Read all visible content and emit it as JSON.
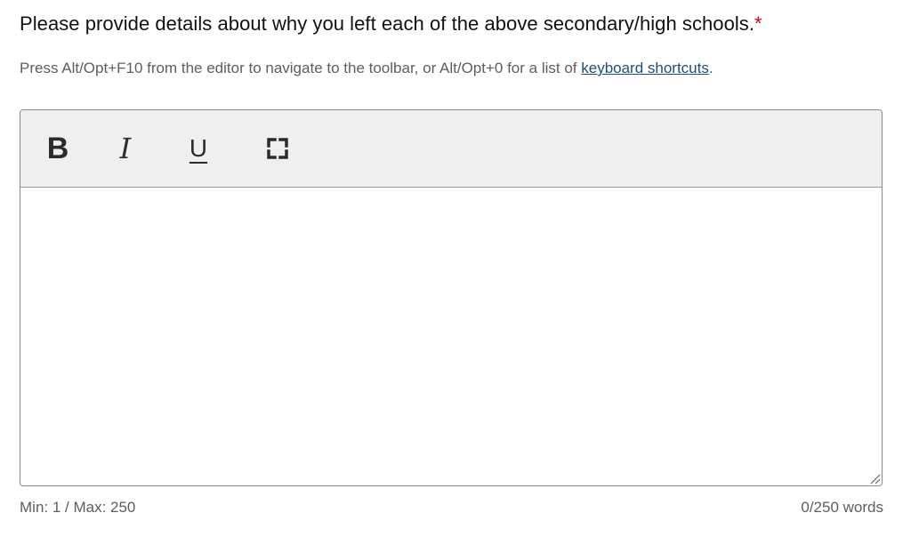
{
  "question": {
    "text": "Please provide details about why you left each of the above secondary/high schools.",
    "required_marker": "*"
  },
  "help": {
    "text": "Press Alt/Opt+F10 from the editor to navigate to the toolbar, or Alt/Opt+0 for a list of ",
    "link_text": "keyboard shortcuts",
    "trailing": "."
  },
  "toolbar": {
    "bold_label": "B",
    "italic_label": "I",
    "underline_label": "U",
    "fullscreen_icon": "fullscreen-icon"
  },
  "editor": {
    "content": ""
  },
  "footer": {
    "limits": "Min: 1 / Max: 250",
    "word_count": "0/250 words"
  },
  "colors": {
    "required": "#d0021b",
    "link": "#1f4e79",
    "toolbar_bg": "#efefef",
    "muted_text": "#5e5e5e"
  }
}
